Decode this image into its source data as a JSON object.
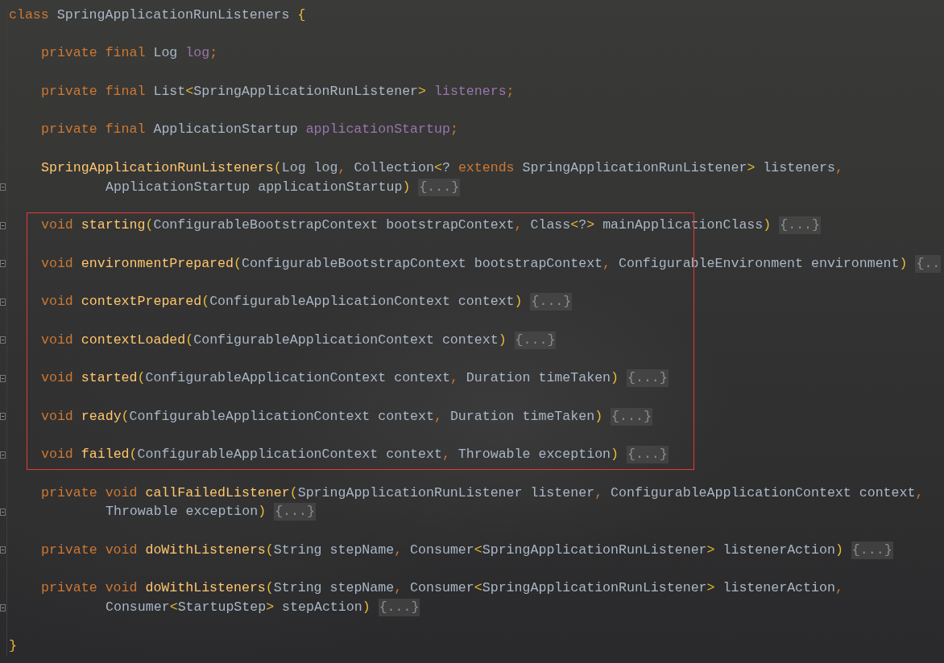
{
  "editor": {
    "sections": [
      {
        "highlighted": false,
        "lines": [
          {
            "kind": "top",
            "tokens": [
              {
                "kind": "keyword",
                "text": "class "
              },
              {
                "kind": "plain",
                "text": "SpringApplicationRunListeners "
              },
              {
                "kind": "bracket",
                "text": "{"
              }
            ]
          },
          {
            "kind": "blank"
          },
          {
            "kind": "member",
            "tokens": [
              {
                "kind": "keyword",
                "text": "private final "
              },
              {
                "kind": "plain",
                "text": "Log "
              },
              {
                "kind": "field",
                "text": "log"
              },
              {
                "kind": "punct",
                "text": ";"
              }
            ]
          },
          {
            "kind": "blank"
          },
          {
            "kind": "member",
            "tokens": [
              {
                "kind": "keyword",
                "text": "private final "
              },
              {
                "kind": "plain",
                "text": "List"
              },
              {
                "kind": "bracket",
                "text": "<"
              },
              {
                "kind": "plain",
                "text": "SpringApplicationRunListener"
              },
              {
                "kind": "bracket",
                "text": "> "
              },
              {
                "kind": "field",
                "text": "listeners"
              },
              {
                "kind": "punct",
                "text": ";"
              }
            ]
          },
          {
            "kind": "blank"
          },
          {
            "kind": "member",
            "tokens": [
              {
                "kind": "keyword",
                "text": "private final "
              },
              {
                "kind": "plain",
                "text": "ApplicationStartup "
              },
              {
                "kind": "field",
                "text": "applicationStartup"
              },
              {
                "kind": "punct",
                "text": ";"
              }
            ]
          },
          {
            "kind": "blank"
          },
          {
            "kind": "member",
            "tokens": [
              {
                "kind": "method",
                "text": "SpringApplicationRunListeners"
              },
              {
                "kind": "bracket",
                "text": "("
              },
              {
                "kind": "plain",
                "text": "Log log"
              },
              {
                "kind": "punct",
                "text": ", "
              },
              {
                "kind": "plain",
                "text": "Collection"
              },
              {
                "kind": "bracket",
                "text": "<"
              },
              {
                "kind": "plain",
                "text": "? "
              },
              {
                "kind": "keyword",
                "text": "extends "
              },
              {
                "kind": "plain",
                "text": "SpringApplicationRunListener"
              },
              {
                "kind": "bracket",
                "text": ">"
              },
              {
                "kind": "plain",
                "text": " listeners"
              },
              {
                "kind": "punct",
                "text": ","
              }
            ]
          },
          {
            "kind": "continuation",
            "tokens": [
              {
                "kind": "plain",
                "text": "ApplicationStartup applicationStartup"
              },
              {
                "kind": "bracket",
                "text": ") "
              },
              {
                "kind": "folded",
                "text": "{...}"
              }
            ]
          },
          {
            "kind": "blank"
          }
        ]
      },
      {
        "highlighted": true,
        "lines": [
          {
            "kind": "member",
            "tokens": [
              {
                "kind": "keyword",
                "text": "void "
              },
              {
                "kind": "method",
                "text": "starting"
              },
              {
                "kind": "bracket",
                "text": "("
              },
              {
                "kind": "plain",
                "text": "ConfigurableBootstrapContext bootstrapContext"
              },
              {
                "kind": "punct",
                "text": ", "
              },
              {
                "kind": "plain",
                "text": "Class"
              },
              {
                "kind": "bracket",
                "text": "<"
              },
              {
                "kind": "plain",
                "text": "?"
              },
              {
                "kind": "bracket",
                "text": ">"
              },
              {
                "kind": "plain",
                "text": " mainApplicationClass"
              },
              {
                "kind": "bracket",
                "text": ") "
              },
              {
                "kind": "folded",
                "text": "{...}"
              }
            ]
          },
          {
            "kind": "blank"
          },
          {
            "kind": "member",
            "tokens": [
              {
                "kind": "keyword",
                "text": "void "
              },
              {
                "kind": "method",
                "text": "environmentPrepared"
              },
              {
                "kind": "bracket",
                "text": "("
              },
              {
                "kind": "plain",
                "text": "ConfigurableBootstrapContext bootstrapContext"
              },
              {
                "kind": "punct",
                "text": ", "
              },
              {
                "kind": "plain",
                "text": "ConfigurableEnvironment environment"
              },
              {
                "kind": "bracket",
                "text": ") "
              },
              {
                "kind": "folded",
                "text": "{.."
              }
            ]
          },
          {
            "kind": "blank"
          },
          {
            "kind": "member",
            "tokens": [
              {
                "kind": "keyword",
                "text": "void "
              },
              {
                "kind": "method",
                "text": "contextPrepared"
              },
              {
                "kind": "bracket",
                "text": "("
              },
              {
                "kind": "plain",
                "text": "ConfigurableApplicationContext context"
              },
              {
                "kind": "bracket",
                "text": ") "
              },
              {
                "kind": "folded",
                "text": "{...}"
              }
            ]
          },
          {
            "kind": "blank"
          },
          {
            "kind": "member",
            "tokens": [
              {
                "kind": "keyword",
                "text": "void "
              },
              {
                "kind": "method",
                "text": "contextLoaded"
              },
              {
                "kind": "bracket",
                "text": "("
              },
              {
                "kind": "plain",
                "text": "ConfigurableApplicationContext context"
              },
              {
                "kind": "bracket",
                "text": ") "
              },
              {
                "kind": "folded",
                "text": "{...}"
              }
            ]
          },
          {
            "kind": "blank"
          },
          {
            "kind": "member",
            "tokens": [
              {
                "kind": "keyword",
                "text": "void "
              },
              {
                "kind": "method",
                "text": "started"
              },
              {
                "kind": "bracket",
                "text": "("
              },
              {
                "kind": "plain",
                "text": "ConfigurableApplicationContext context"
              },
              {
                "kind": "punct",
                "text": ", "
              },
              {
                "kind": "plain",
                "text": "Duration timeTaken"
              },
              {
                "kind": "bracket",
                "text": ") "
              },
              {
                "kind": "folded",
                "text": "{...}"
              }
            ]
          },
          {
            "kind": "blank"
          },
          {
            "kind": "member",
            "tokens": [
              {
                "kind": "keyword",
                "text": "void "
              },
              {
                "kind": "method",
                "text": "ready"
              },
              {
                "kind": "bracket",
                "text": "("
              },
              {
                "kind": "plain",
                "text": "ConfigurableApplicationContext context"
              },
              {
                "kind": "punct",
                "text": ", "
              },
              {
                "kind": "plain",
                "text": "Duration timeTaken"
              },
              {
                "kind": "bracket",
                "text": ") "
              },
              {
                "kind": "folded",
                "text": "{...}"
              }
            ]
          },
          {
            "kind": "blank"
          },
          {
            "kind": "member",
            "tokens": [
              {
                "kind": "keyword",
                "text": "void "
              },
              {
                "kind": "method",
                "text": "failed"
              },
              {
                "kind": "bracket",
                "text": "("
              },
              {
                "kind": "plain",
                "text": "ConfigurableApplicationContext context"
              },
              {
                "kind": "punct",
                "text": ", "
              },
              {
                "kind": "plain",
                "text": "Throwable exception"
              },
              {
                "kind": "bracket",
                "text": ") "
              },
              {
                "kind": "folded",
                "text": "{...}"
              }
            ]
          }
        ]
      },
      {
        "highlighted": false,
        "lines": [
          {
            "kind": "blank"
          },
          {
            "kind": "member",
            "tokens": [
              {
                "kind": "keyword",
                "text": "private void "
              },
              {
                "kind": "method",
                "text": "callFailedListener"
              },
              {
                "kind": "bracket",
                "text": "("
              },
              {
                "kind": "plain",
                "text": "SpringApplicationRunListener listener"
              },
              {
                "kind": "punct",
                "text": ", "
              },
              {
                "kind": "plain",
                "text": "ConfigurableApplicationContext context"
              },
              {
                "kind": "punct",
                "text": ","
              }
            ]
          },
          {
            "kind": "continuation",
            "tokens": [
              {
                "kind": "plain",
                "text": "Throwable exception"
              },
              {
                "kind": "bracket",
                "text": ") "
              },
              {
                "kind": "folded",
                "text": "{...}"
              }
            ]
          },
          {
            "kind": "blank"
          },
          {
            "kind": "member",
            "tokens": [
              {
                "kind": "keyword",
                "text": "private void "
              },
              {
                "kind": "method",
                "text": "doWithListeners"
              },
              {
                "kind": "bracket",
                "text": "("
              },
              {
                "kind": "plain",
                "text": "String stepName"
              },
              {
                "kind": "punct",
                "text": ", "
              },
              {
                "kind": "plain",
                "text": "Consumer"
              },
              {
                "kind": "bracket",
                "text": "<"
              },
              {
                "kind": "plain",
                "text": "SpringApplicationRunListener"
              },
              {
                "kind": "bracket",
                "text": ">"
              },
              {
                "kind": "plain",
                "text": " listenerAction"
              },
              {
                "kind": "bracket",
                "text": ") "
              },
              {
                "kind": "folded",
                "text": "{...}"
              }
            ]
          },
          {
            "kind": "blank"
          },
          {
            "kind": "member",
            "tokens": [
              {
                "kind": "keyword",
                "text": "private void "
              },
              {
                "kind": "method",
                "text": "doWithListeners"
              },
              {
                "kind": "bracket",
                "text": "("
              },
              {
                "kind": "plain",
                "text": "String stepName"
              },
              {
                "kind": "punct",
                "text": ", "
              },
              {
                "kind": "plain",
                "text": "Consumer"
              },
              {
                "kind": "bracket",
                "text": "<"
              },
              {
                "kind": "plain",
                "text": "SpringApplicationRunListener"
              },
              {
                "kind": "bracket",
                "text": ">"
              },
              {
                "kind": "plain",
                "text": " listenerAction"
              },
              {
                "kind": "punct",
                "text": ","
              }
            ]
          },
          {
            "kind": "continuation",
            "tokens": [
              {
                "kind": "plain",
                "text": "Consumer"
              },
              {
                "kind": "bracket",
                "text": "<"
              },
              {
                "kind": "plain",
                "text": "StartupStep"
              },
              {
                "kind": "bracket",
                "text": ">"
              },
              {
                "kind": "plain",
                "text": " stepAction"
              },
              {
                "kind": "bracket",
                "text": ") "
              },
              {
                "kind": "folded",
                "text": "{...}"
              }
            ]
          },
          {
            "kind": "blank"
          },
          {
            "kind": "top",
            "tokens": [
              {
                "kind": "bracket",
                "text": "}"
              }
            ]
          }
        ]
      }
    ]
  }
}
